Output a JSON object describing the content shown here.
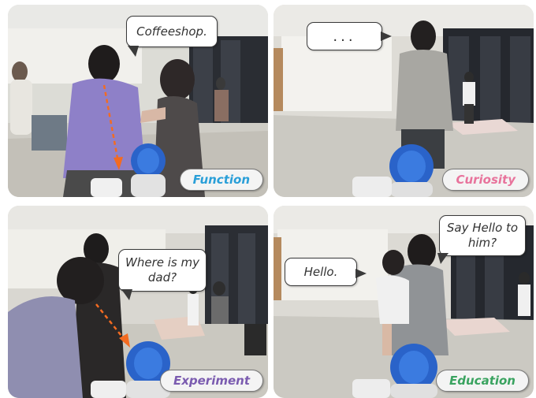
{
  "panels": [
    {
      "label": "Function",
      "label_color": "#2a9fd8",
      "bubbles": [
        {
          "text": "Coffeeshop."
        }
      ]
    },
    {
      "label": "Curiosity",
      "label_color": "#e8739c",
      "bubbles": [
        {
          "text": "..."
        }
      ]
    },
    {
      "label": "Experiment",
      "label_color": "#7b5cb0",
      "bubbles": [
        {
          "text": "Where is my dad?"
        }
      ]
    },
    {
      "label": "Education",
      "label_color": "#3aa360",
      "bubbles": [
        {
          "text": "Hello."
        },
        {
          "text": "Say Hello to him?"
        }
      ]
    }
  ],
  "icons": [
    "robot-icon",
    "arrow-pointer-icon"
  ]
}
